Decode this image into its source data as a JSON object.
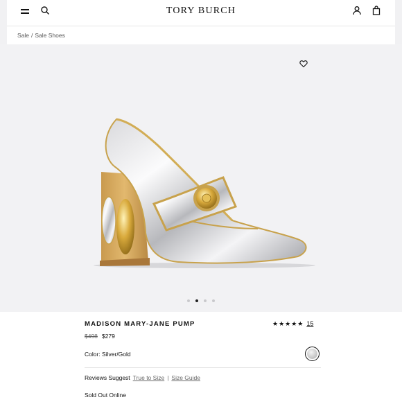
{
  "header": {
    "brand": "TORY BURCH",
    "icons": [
      "menu-icon",
      "search-icon",
      "account-icon",
      "bag-icon"
    ]
  },
  "breadcrumb": {
    "items": [
      "Sale",
      "Sale Shoes"
    ],
    "separator": "/"
  },
  "gallery": {
    "dots_total": 4,
    "active_index": 1
  },
  "product": {
    "name": "MADISON MARY-JANE PUMP",
    "rating_stars": "★★★★★",
    "review_count": "15",
    "price_original": "$498",
    "price_sale": "$279",
    "color_label": "Color: Silver/Gold",
    "reviews_suggest": "Reviews Suggest",
    "true_to_size": "True to Size",
    "size_sep": "|",
    "size_guide": "Size Guide",
    "availability": "Sold Out Online"
  },
  "colors": {
    "background": "#f1f1f3",
    "text": "#111111",
    "muted": "#666666"
  }
}
